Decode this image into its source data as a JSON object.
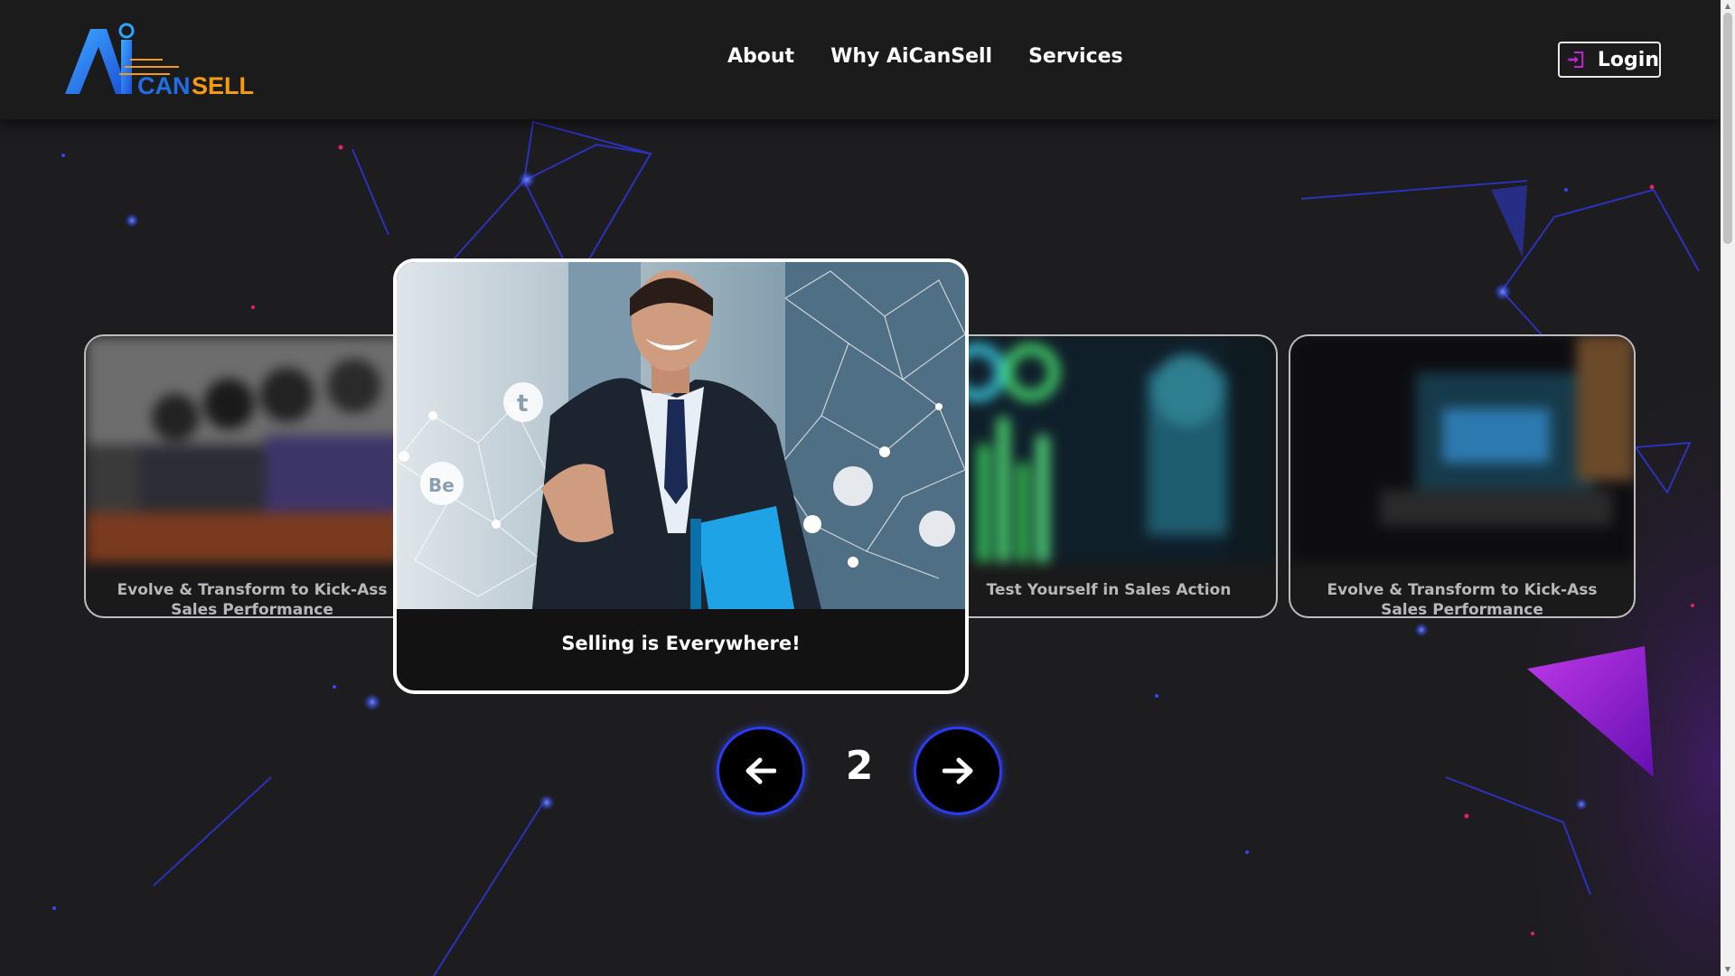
{
  "header": {
    "logo": {
      "text_ai": "Ai",
      "text_can": "CAN",
      "text_sell": "SELL"
    },
    "nav": [
      {
        "label": "About"
      },
      {
        "label": "Why AiCanSell"
      },
      {
        "label": "Services"
      }
    ],
    "login": {
      "label": "Login",
      "icon": "login-icon"
    }
  },
  "carousel": {
    "cards": [
      {
        "caption": "Evolve & Transform to Kick-Ass Sales Performance"
      },
      {
        "caption": "Selling is Everywhere!"
      },
      {
        "caption": "Test Yourself in Sales Action"
      },
      {
        "caption": "Evolve & Transform to Kick-Ass Sales Performance"
      }
    ],
    "active_index": 1,
    "page_number": "2",
    "prev_icon": "arrow-left-icon",
    "next_icon": "arrow-right-icon"
  },
  "colors": {
    "background": "#1d1d1f",
    "header": "#1b1b1b",
    "accent_blue": "#2a3cf2",
    "logo_blue": "#1e6fe6",
    "logo_orange": "#f39c12",
    "login_icon_magenta": "#c026d3"
  }
}
